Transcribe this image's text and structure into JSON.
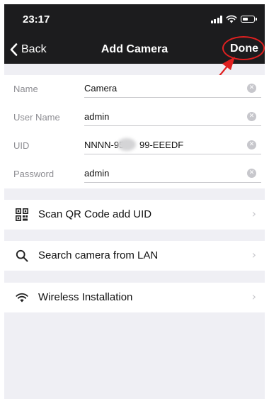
{
  "status_bar": {
    "time": "23:17"
  },
  "nav": {
    "back_label": "Back",
    "title": "Add Camera",
    "done_label": "Done"
  },
  "form": {
    "fields": [
      {
        "label": "Name",
        "value": "Camera"
      },
      {
        "label": "User Name",
        "value": "admin"
      },
      {
        "label": "UID",
        "value": "NNNN-95      99-EEEDF"
      },
      {
        "label": "Password",
        "value": "admin"
      }
    ]
  },
  "options": [
    {
      "label": "Scan QR Code add UID",
      "icon": "qr-code-icon"
    },
    {
      "label": "Search camera from LAN",
      "icon": "search-icon"
    },
    {
      "label": "Wireless Installation",
      "icon": "wifi-icon"
    }
  ],
  "colors": {
    "bar": "#1c1c1e",
    "background": "#efeff4",
    "annotation": "#e02020"
  }
}
